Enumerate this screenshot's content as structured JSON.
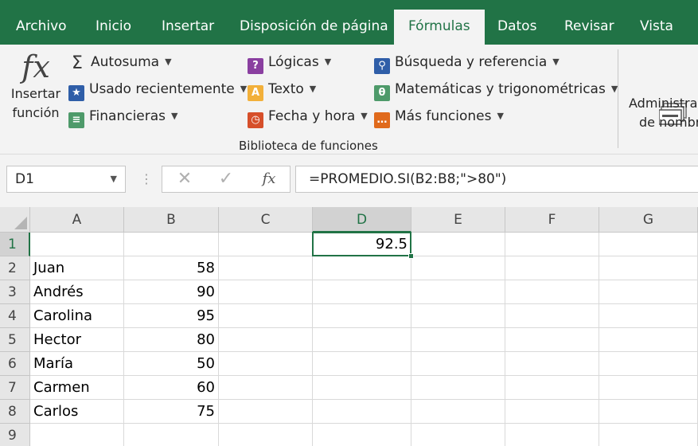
{
  "ribbon": {
    "tabs": [
      "Archivo",
      "Inicio",
      "Insertar",
      "Disposición de página",
      "Fórmulas",
      "Datos",
      "Revisar",
      "Vista"
    ],
    "active_tab": "Fórmulas",
    "insert_function": {
      "line1": "Insertar",
      "line2": "función",
      "icon": "fx-icon"
    },
    "col1": [
      {
        "label": "Autosuma",
        "icon": "sigma-icon"
      },
      {
        "label": "Usado recientemente",
        "icon": "star-book-icon"
      },
      {
        "label": "Financieras",
        "icon": "financial-book-icon"
      }
    ],
    "col2": [
      {
        "label": "Lógicas",
        "icon": "question-book-icon"
      },
      {
        "label": "Texto",
        "icon": "text-book-icon"
      },
      {
        "label": "Fecha y hora",
        "icon": "clock-book-icon"
      }
    ],
    "col3": [
      {
        "label": "Búsqueda y referencia",
        "icon": "magnifier-book-icon"
      },
      {
        "label": "Matemáticas y trigonométricas",
        "icon": "theta-book-icon"
      },
      {
        "label": "Más funciones",
        "icon": "ellipsis-book-icon"
      }
    ],
    "group_label": "Biblioteca de funciones",
    "name_manager": {
      "line1": "Administra",
      "line2": "de nombr",
      "icon": "name-manager-icon"
    }
  },
  "formula_bar": {
    "name_box": "D1",
    "formula": "=PROMEDIO.SI(B2:B8;\">80\")"
  },
  "sheet": {
    "columns": [
      "A",
      "B",
      "C",
      "D",
      "E",
      "F",
      "G"
    ],
    "rows": [
      "1",
      "2",
      "3",
      "4",
      "5",
      "6",
      "7",
      "8",
      "9"
    ],
    "selected_cell": "D1",
    "data": [
      [
        "",
        "",
        "",
        "92.5",
        "",
        "",
        ""
      ],
      [
        "Juan",
        "58",
        "",
        "",
        "",
        "",
        ""
      ],
      [
        "Andrés",
        "90",
        "",
        "",
        "",
        "",
        ""
      ],
      [
        "Carolina",
        "95",
        "",
        "",
        "",
        "",
        ""
      ],
      [
        "Hector",
        "80",
        "",
        "",
        "",
        "",
        ""
      ],
      [
        "María",
        "50",
        "",
        "",
        "",
        "",
        ""
      ],
      [
        "Carmen",
        "60",
        "",
        "",
        "",
        "",
        ""
      ],
      [
        "Carlos",
        "75",
        "",
        "",
        "",
        "",
        ""
      ],
      [
        "",
        "",
        "",
        "",
        "",
        "",
        ""
      ]
    ],
    "colors": {
      "accent": "#217346",
      "header_bg": "#e6e6e6",
      "grid_line": "#d9d9d9"
    }
  }
}
